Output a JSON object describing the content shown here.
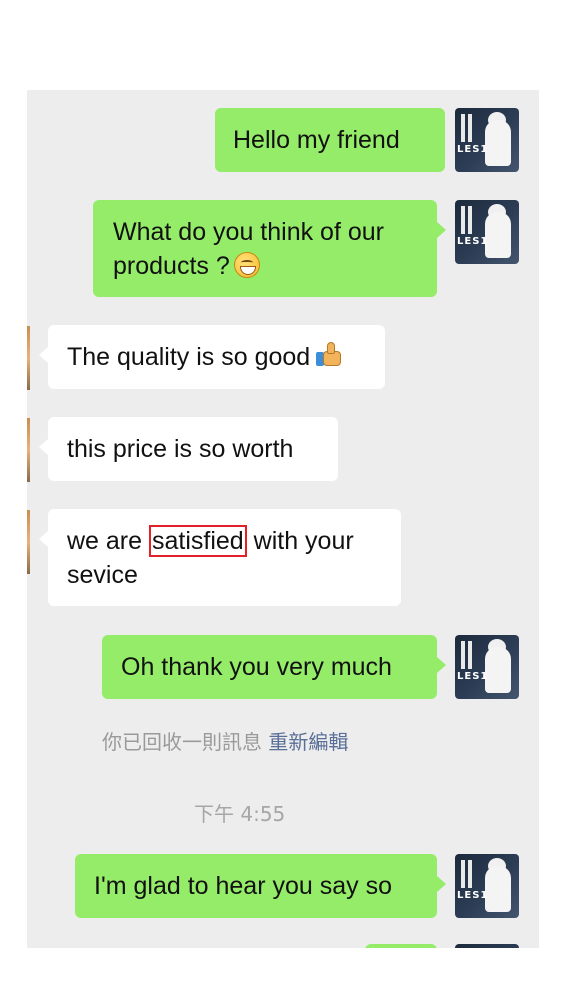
{
  "messages": {
    "m1": "Hello my friend",
    "m2": "What do you think of our products ?",
    "m3": "The quality is so good",
    "m4": "this price is so worth",
    "m5_before": "we are ",
    "m5_highlight": "satisfied",
    "m5_after": " with your sevice",
    "m6": "Oh thank you very much",
    "m7": "I'm glad to hear you say so"
  },
  "system_notice": {
    "text": "你已回收一則訊息",
    "action": "重新編輯"
  },
  "timestamp": "下午 4:55",
  "avatar": {
    "caption": "LES1"
  },
  "colors": {
    "outgoing_bubble": "#95ec69",
    "incoming_bubble": "#ffffff",
    "chat_background": "#ededed",
    "highlight_box": "#e0202a",
    "action_link": "#5a6f98"
  },
  "icons": [
    "grinning-emoji-icon",
    "thumbs-up-emoji-icon"
  ]
}
